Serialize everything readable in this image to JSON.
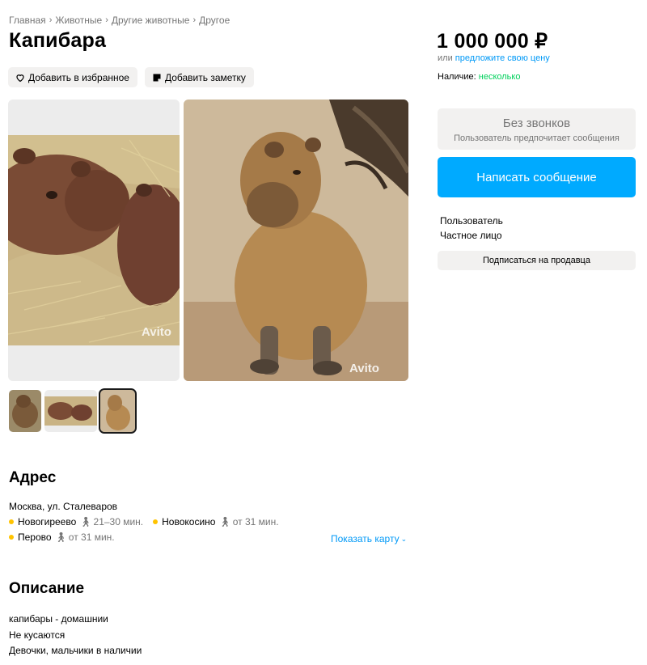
{
  "breadcrumb": [
    "Главная",
    "Животные",
    "Другие животные",
    "Другое"
  ],
  "title": "Капибара",
  "actions": {
    "favorite": "Добавить в избранное",
    "note": "Добавить заметку"
  },
  "price": "1 000 000 ₽",
  "offer": {
    "prefix": "или",
    "link": "предложите свою цену"
  },
  "availability": {
    "label": "Наличие:",
    "value": "несколько"
  },
  "no_calls": {
    "title": "Без звонков",
    "subtitle": "Пользователь предпочитает сообщения"
  },
  "message_button": "Написать сообщение",
  "seller": {
    "name": "Пользователь",
    "type": "Частное лицо"
  },
  "subscribe_button": "Подписаться на продавца",
  "gallery": {
    "watermark": "Avito",
    "selected_index": 2,
    "thumb_count": 3
  },
  "address": {
    "heading": "Адрес",
    "text": "Москва, ул. Сталеваров",
    "metro": [
      {
        "station": "Новогиреево",
        "time": "21–30 мин."
      },
      {
        "station": "Новокосино",
        "time": "от 31 мин."
      },
      {
        "station": "Перово",
        "time": "от 31 мин."
      }
    ],
    "show_map": "Показать карту"
  },
  "description": {
    "heading": "Описание",
    "lines": [
      "капибары - домашнии",
      "Не кусаются",
      "Девочки, мальчики в наличии"
    ]
  },
  "colors": {
    "accent": "#00aaff",
    "link": "#0099f7",
    "available": "#02d15c",
    "metro": "#ffc300"
  }
}
